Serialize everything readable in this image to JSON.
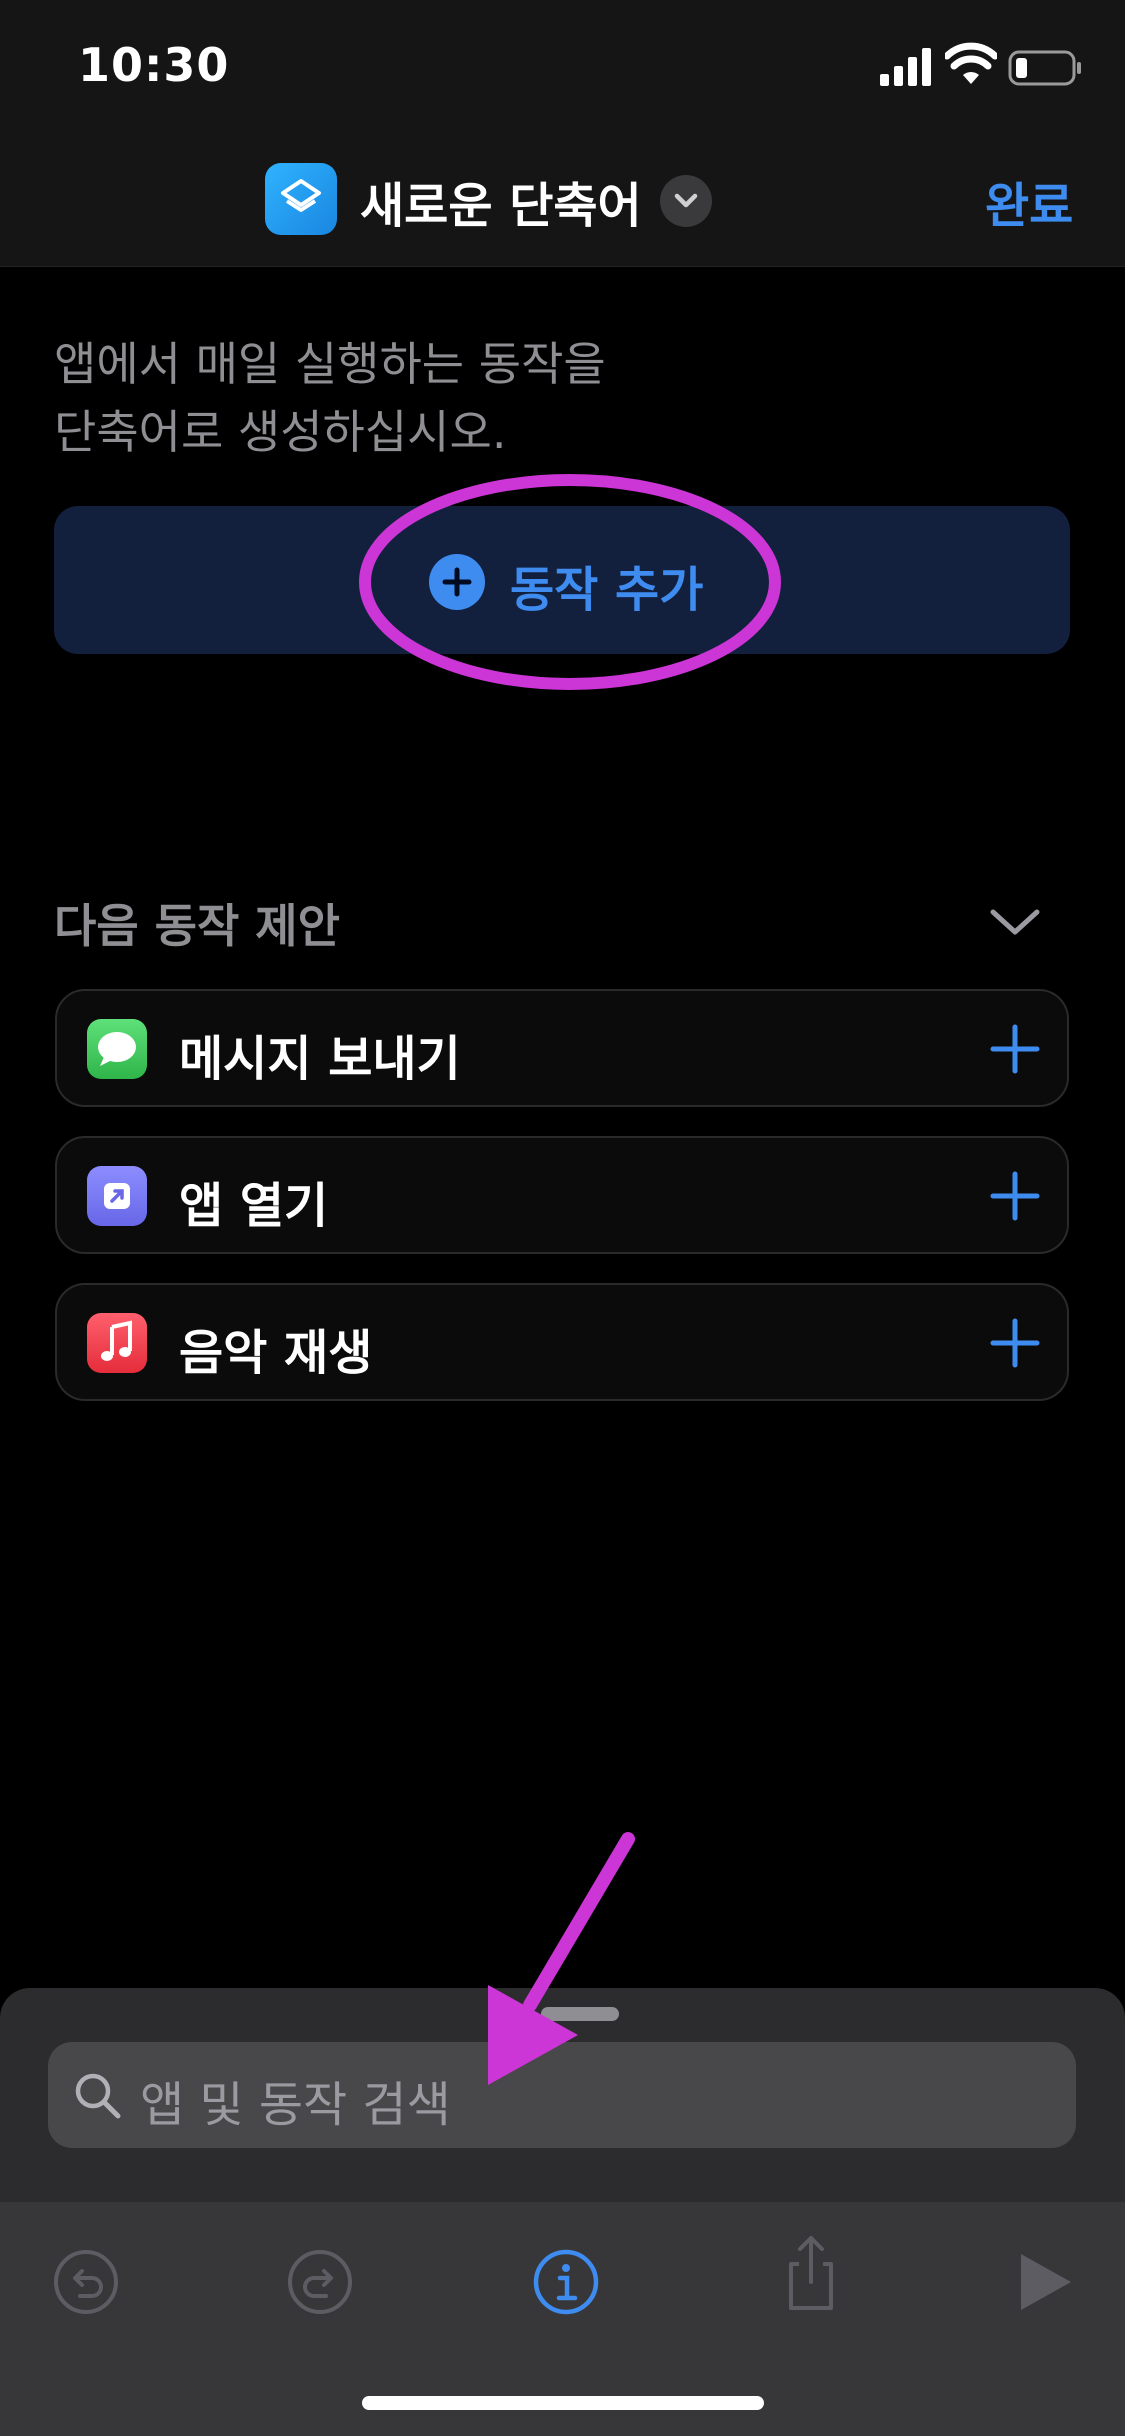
{
  "status_bar": {
    "time": "10:30",
    "battery_level": 0.2
  },
  "nav": {
    "title": "새로운 단축어",
    "done_label": "완료"
  },
  "main": {
    "intro_text": "앱에서 매일 실행하는 동작을\n단축어로 생성하십시오.",
    "add_action_label": "동작 추가"
  },
  "suggestions": {
    "header": "다음 동작 제안",
    "items": [
      {
        "label": "메시지 보내기",
        "icon": "messages-icon",
        "color": "#34c759"
      },
      {
        "label": "앱 열기",
        "icon": "open-app-icon",
        "color": "#7f7ff5"
      },
      {
        "label": "음악 재생",
        "icon": "music-icon",
        "color": "#fc3c44"
      }
    ]
  },
  "search": {
    "placeholder": "앱 및 동작 검색"
  },
  "toolbar": {
    "items": [
      "undo-icon",
      "redo-icon",
      "info-icon",
      "share-icon",
      "play-icon"
    ]
  },
  "colors": {
    "accent": "#3e8cf0",
    "annotation": "#cc35d6"
  }
}
